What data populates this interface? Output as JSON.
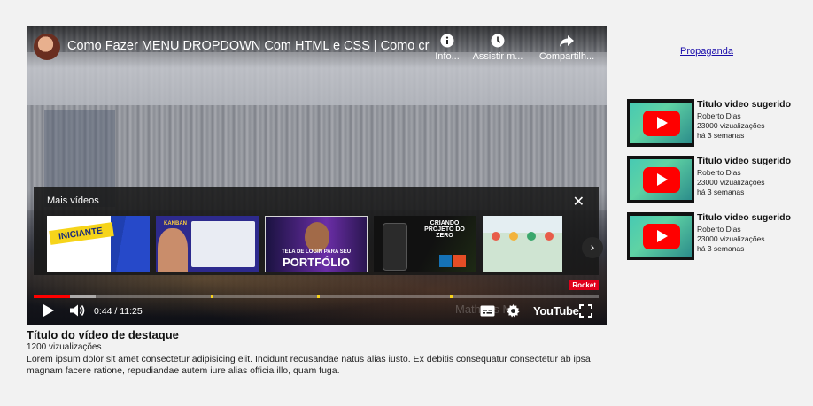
{
  "player": {
    "title": "Como Fazer MENU DROPDOWN Com HTML e CSS | Como criar Su...",
    "actions": [
      {
        "label": "Info...",
        "icon": "info-icon"
      },
      {
        "label": "Assistir m...",
        "icon": "clock-icon"
      },
      {
        "label": "Compartilh...",
        "icon": "share-icon"
      }
    ],
    "more_videos": {
      "heading": "Mais vídeos",
      "thumbnails": [
        {
          "text": "INICIANTE"
        },
        {
          "text": "KANBAN"
        },
        {
          "small_text": "TELA DE LOGIN PARA SEU",
          "text": "PORTFÓLIO"
        },
        {
          "text": "CRIANDO PROJETO DO ZERO"
        },
        {
          "text": ""
        }
      ]
    },
    "progress": {
      "played_fraction": 0.065,
      "buffered_fraction": 0.11
    },
    "time": "0:44 / 11:25",
    "brand": "YouTube",
    "badge": "Rocket",
    "watermark": "Matheus M"
  },
  "feature": {
    "title": "Título do vídeo de destaque",
    "views": "1200 vizualizações",
    "description": "Lorem ipsum dolor sit amet consectetur adipisicing elit. Incidunt recusandae natus alias iusto. Ex debitis consequatur consectetur ab ipsa magnam facere ratione, repudiandae autem iure alias officia illo, quam fuga."
  },
  "sidebar": {
    "ad_label": "Propaganda",
    "suggestions": [
      {
        "title": "Titulo video sugerido",
        "channel": "Roberto Dias",
        "views": "23000 vizualizações",
        "age": "há 3 semanas"
      },
      {
        "title": "Titulo video sugerido",
        "channel": "Roberto Dias",
        "views": "23000 vizualizações",
        "age": "há 3 semanas"
      },
      {
        "title": "Titulo video sugerido",
        "channel": "Roberto Dias",
        "views": "23000 vizualizações",
        "age": "há 3 semanas"
      }
    ]
  },
  "colors": {
    "progress_played": "#ff0000",
    "youtube_red": "#ff0000",
    "link": "#1a0dab"
  }
}
